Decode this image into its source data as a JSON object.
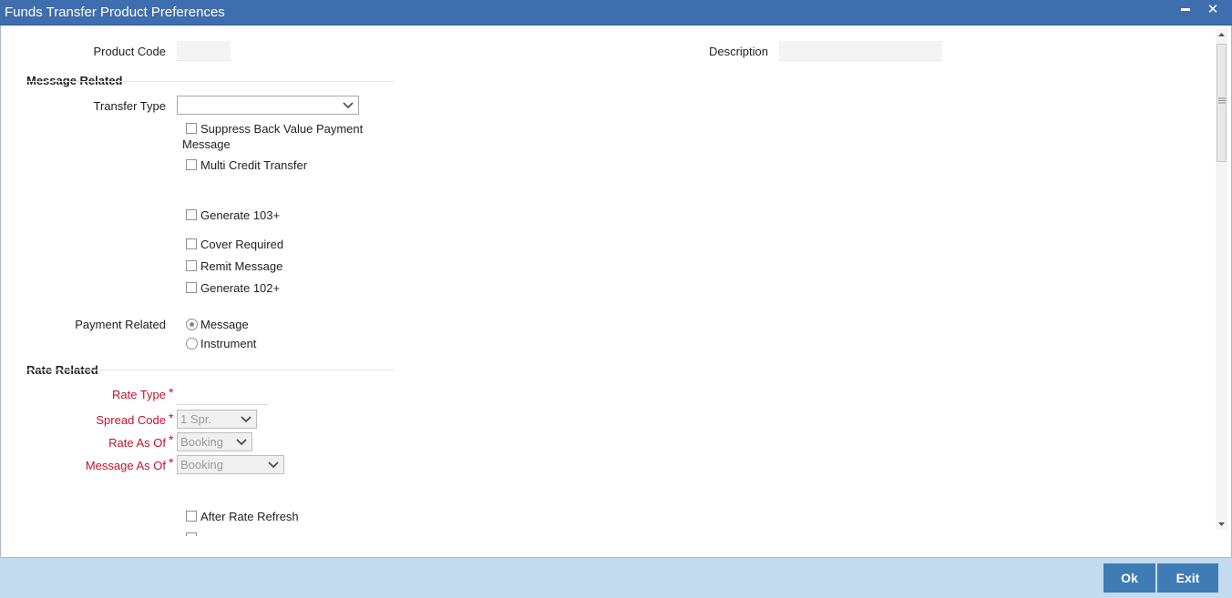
{
  "window": {
    "title": "Funds Transfer Product Preferences",
    "minimize_glyph": "▬",
    "close_glyph": "✕"
  },
  "header": {
    "product_code_label": "Product Code",
    "product_code_value": "",
    "description_label": "Description",
    "description_value": ""
  },
  "message_related": {
    "heading": "Message Related",
    "transfer_type_label": "Transfer Type",
    "transfer_type_value": "",
    "suppress_back_value_line1": "Suppress Back Value Payment",
    "suppress_back_value_line2": "Message",
    "multi_credit_transfer": "Multi Credit Transfer",
    "generate_103plus": "Generate 103+",
    "cover_required": "Cover Required",
    "remit_message": "Remit Message",
    "generate_102plus": "Generate 102+",
    "payment_related_label": "Payment Related",
    "payment_message": "Message",
    "payment_instrument": "Instrument"
  },
  "rate_related": {
    "heading": "Rate Related",
    "rate_type_label": "Rate Type",
    "rate_type_value": "",
    "spread_code_label": "Spread Code",
    "spread_code_value": "1 Spr.",
    "rate_as_of_label": "Rate As Of",
    "rate_as_of_value": "Booking",
    "message_as_of_label": "Message As Of",
    "message_as_of_value": "Booking",
    "after_rate_refresh": "After Rate Refresh",
    "required_mark": "*"
  },
  "footer": {
    "ok_label": "Ok",
    "exit_label": "Exit"
  },
  "colors": {
    "titlebar": "#3f6eae",
    "footer": "#c3dbee",
    "button": "#3f7cb5",
    "required": "#c8102e"
  }
}
